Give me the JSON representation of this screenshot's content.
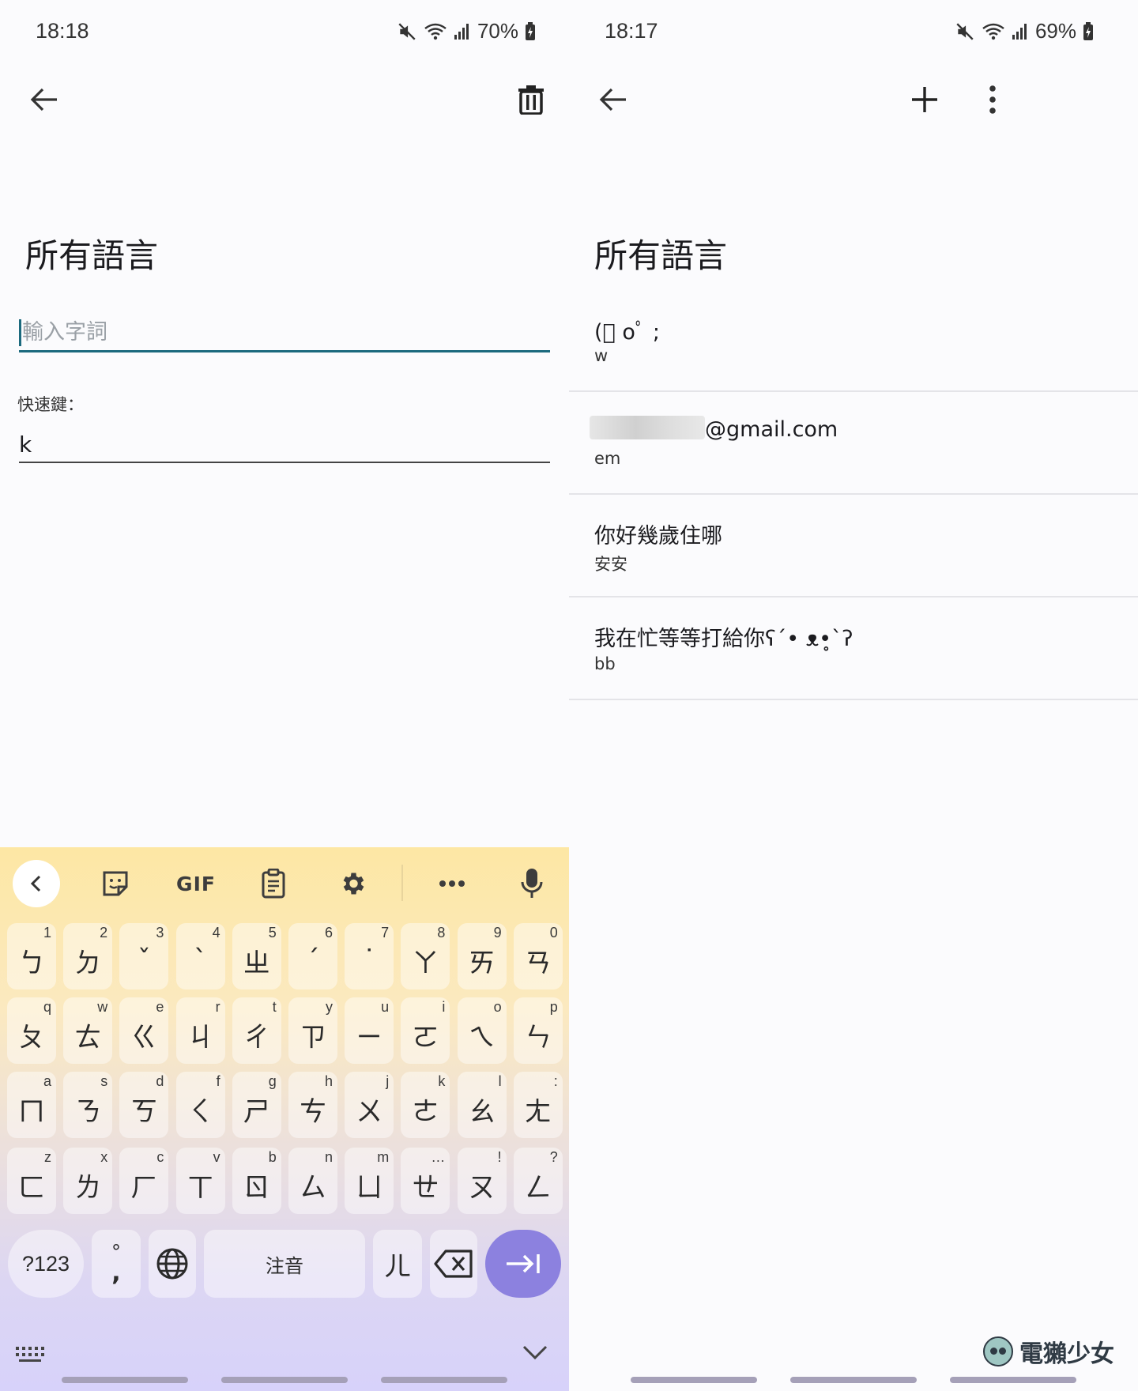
{
  "left": {
    "status": {
      "time": "18:18",
      "battery": "70%"
    },
    "title": "所有語言",
    "word_input": {
      "placeholder": "輸入字詞",
      "value": ""
    },
    "shortcut_label": "快速鍵：",
    "shortcut_value": "k",
    "icons": {
      "back": "arrow-left-icon",
      "delete": "trash-icon"
    }
  },
  "keyboard": {
    "toolbar": {
      "gif_label": "GIF"
    },
    "rows": [
      [
        {
          "m": "ㄅ",
          "s": "1"
        },
        {
          "m": "ㄉ",
          "s": "2"
        },
        {
          "m": "ˇ",
          "s": "3"
        },
        {
          "m": "ˋ",
          "s": "4"
        },
        {
          "m": "ㄓ",
          "s": "5"
        },
        {
          "m": "ˊ",
          "s": "6"
        },
        {
          "m": "˙",
          "s": "7"
        },
        {
          "m": "ㄚ",
          "s": "8"
        },
        {
          "m": "ㄞ",
          "s": "9"
        },
        {
          "m": "ㄢ",
          "s": "0"
        }
      ],
      [
        {
          "m": "ㄆ",
          "s": "q"
        },
        {
          "m": "ㄊ",
          "s": "w"
        },
        {
          "m": "ㄍ",
          "s": "e"
        },
        {
          "m": "ㄐ",
          "s": "r"
        },
        {
          "m": "ㄔ",
          "s": "t"
        },
        {
          "m": "ㄗ",
          "s": "y"
        },
        {
          "m": "ㄧ",
          "s": "u"
        },
        {
          "m": "ㄛ",
          "s": "i"
        },
        {
          "m": "ㄟ",
          "s": "o"
        },
        {
          "m": "ㄣ",
          "s": "p"
        }
      ],
      [
        {
          "m": "ㄇ",
          "s": "a"
        },
        {
          "m": "ㄋ",
          "s": "s"
        },
        {
          "m": "ㄎ",
          "s": "d"
        },
        {
          "m": "ㄑ",
          "s": "f"
        },
        {
          "m": "ㄕ",
          "s": "g"
        },
        {
          "m": "ㄘ",
          "s": "h"
        },
        {
          "m": "ㄨ",
          "s": "j"
        },
        {
          "m": "ㄜ",
          "s": "k"
        },
        {
          "m": "ㄠ",
          "s": "l"
        },
        {
          "m": "ㄤ",
          "s": ":"
        }
      ],
      [
        {
          "m": "ㄈ",
          "s": "z"
        },
        {
          "m": "ㄌ",
          "s": "x"
        },
        {
          "m": "ㄏ",
          "s": "c"
        },
        {
          "m": "ㄒ",
          "s": "v"
        },
        {
          "m": "ㄖ",
          "s": "b"
        },
        {
          "m": "ㄙ",
          "s": "n"
        },
        {
          "m": "ㄩ",
          "s": "m"
        },
        {
          "m": "ㄝ",
          "s": "…"
        },
        {
          "m": "ㄡ",
          "s": "!"
        },
        {
          "m": "ㄥ",
          "s": "?"
        }
      ]
    ],
    "bottom_row": {
      "symbols": "?123",
      "punct_top": "°",
      "punct_bottom": ",",
      "space": "注音",
      "er": "ㄦ"
    }
  },
  "right": {
    "status": {
      "time": "18:17",
      "battery": "69%"
    },
    "title": "所有語言",
    "entries": [
      {
        "phrase": "(ﾟ oﾟ ;",
        "shortcut": "w"
      },
      {
        "phrase": "@gmail.com",
        "shortcut": "em"
      },
      {
        "phrase": "你好幾歲住哪",
        "shortcut": "安安"
      },
      {
        "phrase": "我在忙等等打給你ʕ´• ᴥ•̥`ʔ",
        "shortcut": "bb"
      }
    ],
    "watermark": "電獺少女"
  },
  "colors": {
    "accent": "#1c6a7e",
    "enter_key": "#8c81df"
  }
}
